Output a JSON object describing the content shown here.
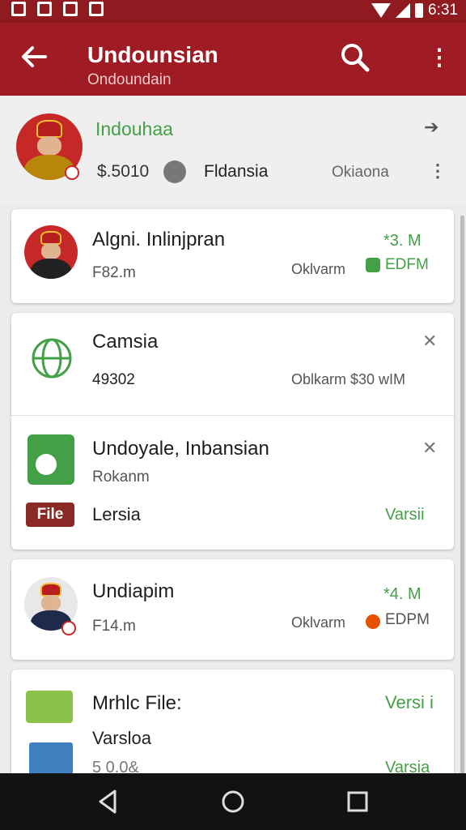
{
  "status_bar": {
    "time": "6:31"
  },
  "app_bar": {
    "title": "Undounsian",
    "subtitle": "Ondoundain"
  },
  "header": {
    "name": "Indouhaa",
    "price": "$.5010",
    "location": "Fldansia",
    "right_text": "Okiaona"
  },
  "items": [
    {
      "title": "Algni. Inlinjpran",
      "sub": "F82.m",
      "right": "Oklvarm",
      "rating": "*3. M",
      "tag": "EDFM"
    },
    {
      "title": "Camsia",
      "sub": "49302",
      "right": "Oblkarm  $30 wIM"
    },
    {
      "title": "Undoyale, Inbansian",
      "sub": "Rokanm",
      "file_label": "File",
      "file_text": "Lersia",
      "version": "Varsii"
    },
    {
      "title": "Undiapim",
      "sub": "F14.m",
      "right": "Oklvarm",
      "rating": "*4. M",
      "tag": "EDPM"
    },
    {
      "title": "Mrhlc File:",
      "sub": "Varsloa",
      "sub2": "5 0.0&",
      "version": "Versi i",
      "version2": "Varsia"
    }
  ],
  "colors": {
    "app_bar": "#a01c24",
    "status_bar": "#8f1a20",
    "accent_green": "#43a047",
    "file_badge": "#8b2a24"
  },
  "icons": [
    "back-arrow-icon",
    "search-icon",
    "more-vert-icon",
    "arrow-right-icon",
    "car-icon",
    "globe-icon",
    "close-icon",
    "android-file-icon",
    "book-icon",
    "nav-back-icon",
    "nav-home-icon",
    "nav-recents-icon"
  ]
}
